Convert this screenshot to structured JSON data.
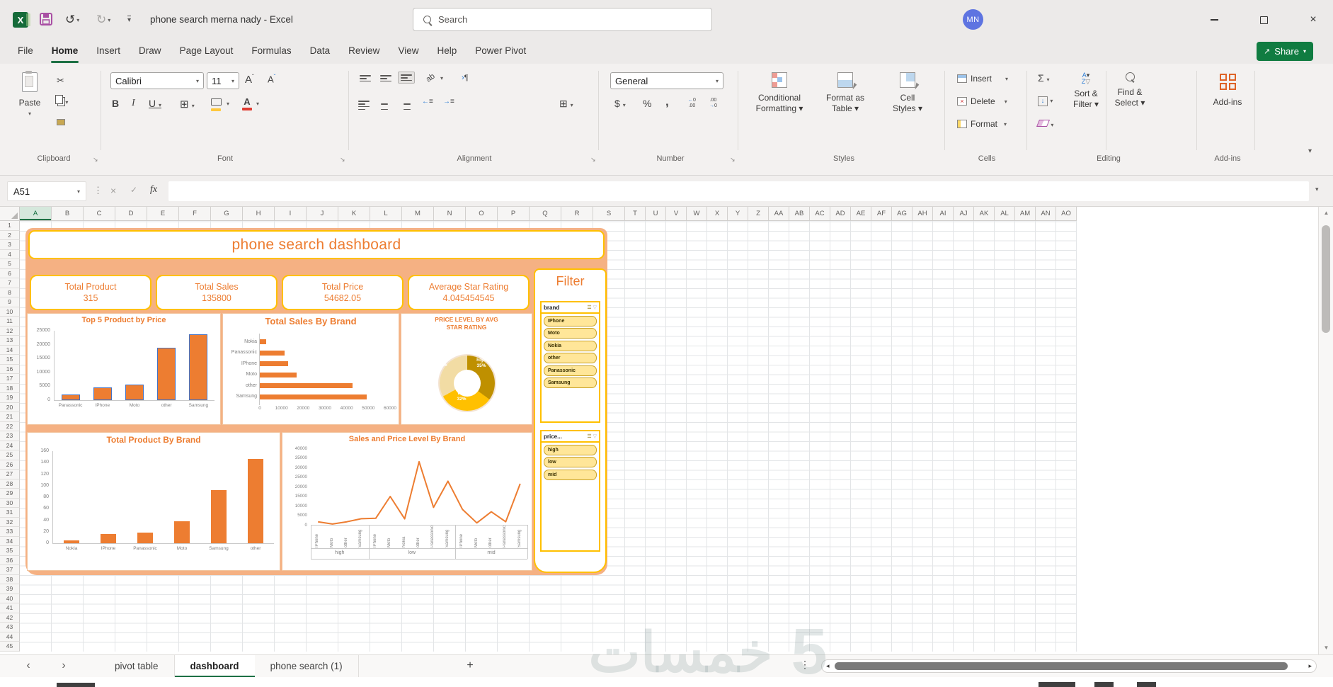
{
  "app": {
    "title": "phone search merna nady  -  Excel",
    "search_placeholder": "Search",
    "avatar": "MN"
  },
  "menu": {
    "tabs": [
      "File",
      "Home",
      "Insert",
      "Draw",
      "Page Layout",
      "Formulas",
      "Data",
      "Review",
      "View",
      "Help",
      "Power Pivot"
    ],
    "active_tab": "Home",
    "share_label": "Share"
  },
  "ribbon": {
    "paste": "Paste",
    "font_name": "Calibri",
    "font_size": "11",
    "number_format": "General",
    "conditional_formatting": [
      "Conditional",
      "Formatting ▾"
    ],
    "format_as_table": [
      "Format as",
      "Table ▾"
    ],
    "cell_styles": [
      "Cell",
      "Styles ▾"
    ],
    "insert": "Insert",
    "delete": "Delete",
    "format": "Format",
    "sort_filter": [
      "Sort &",
      "Filter ▾"
    ],
    "find_select": [
      "Find &",
      "Select ▾"
    ],
    "addins_label": "Add-ins",
    "groups": [
      "Clipboard",
      "Font",
      "Alignment",
      "Number",
      "Styles",
      "Cells",
      "Editing",
      "Add-ins"
    ]
  },
  "formula_bar": {
    "name_box": "A51",
    "fx": "fx"
  },
  "sheet": {
    "columns_narrow": [
      "A",
      "B",
      "C",
      "D",
      "E",
      "F",
      "G",
      "H",
      "I",
      "J",
      "K",
      "L",
      "M",
      "N",
      "O",
      "P",
      "Q",
      "R",
      "S"
    ],
    "columns_wide": [
      "T",
      "U",
      "V",
      "W",
      "X",
      "Y",
      "Z",
      "AA",
      "AB",
      "AC",
      "AD",
      "AE",
      "AF",
      "AG",
      "AH",
      "AI",
      "AJ",
      "AK",
      "AL",
      "AM",
      "AN",
      "AO"
    ],
    "row_count": 45,
    "selected_column": "A"
  },
  "dashboard": {
    "title": "phone search dashboard",
    "kpis": [
      {
        "label": "Total Product",
        "value": "315"
      },
      {
        "label": "Total Sales",
        "value": "135800"
      },
      {
        "label": "Total Price",
        "value": "54682.05"
      },
      {
        "label": "Average Star Rating",
        "value": "4.045454545"
      }
    ],
    "filter": {
      "title": "Filter",
      "slicers": [
        {
          "header": "brand",
          "items": [
            "IPhone",
            "Moto",
            "Nokia",
            "other",
            "Panassonic",
            "Samsung"
          ]
        },
        {
          "header": "price...",
          "items": [
            "high",
            "low",
            "mid"
          ]
        }
      ]
    }
  },
  "chart_data": [
    {
      "type": "bar",
      "title": "Top 5 Product by Price",
      "categories": [
        "Panassonic",
        "IPhone",
        "Moto",
        "other",
        "Samsung"
      ],
      "values": [
        2000,
        4600,
        5700,
        19000,
        23800
      ],
      "ylim": [
        0,
        25000
      ],
      "yticks": [
        0,
        5000,
        10000,
        15000,
        20000,
        25000
      ],
      "bar_color": "#ED7D31",
      "bar_border": "#4472C4"
    },
    {
      "type": "bar",
      "orientation": "horizontal",
      "title": "Total Sales By Brand",
      "categories": [
        "Nokia",
        "Panassonic",
        "IPhone",
        "Moto",
        "other",
        "Samsung"
      ],
      "values": [
        3000,
        11300,
        13100,
        17000,
        42600,
        49200
      ],
      "xlim": [
        0,
        60000
      ],
      "xticks": [
        0,
        10000,
        20000,
        30000,
        40000,
        50000,
        60000
      ],
      "bar_color": "#ED7D31"
    },
    {
      "type": "pie",
      "title": [
        "PRICE LEVEL BY AVG",
        "STAR RATING"
      ],
      "labels": [
        "high",
        "low",
        "mid"
      ],
      "values": [
        35,
        32,
        33
      ],
      "unit": "%",
      "colors": [
        "#BF9000",
        "#FFC000",
        "#F2DCA4"
      ]
    },
    {
      "type": "bar",
      "title": "Total Product By Brand",
      "categories": [
        "Nokia",
        "IPhone",
        "Panassonic",
        "Moto",
        "Samsung",
        "other"
      ],
      "values": [
        5,
        16,
        18,
        38,
        92,
        146
      ],
      "ylim": [
        0,
        160
      ],
      "yticks": [
        0,
        20,
        40,
        60,
        80,
        100,
        120,
        140,
        160
      ],
      "bar_color": "#ED7D31"
    },
    {
      "type": "line",
      "title": "Sales and Price Level By Brand",
      "ylim": [
        0,
        40000
      ],
      "yticks": [
        0,
        5000,
        10000,
        15000,
        20000,
        25000,
        30000,
        35000,
        40000
      ],
      "line_color": "#ED7D31",
      "groups": [
        {
          "label": "high",
          "categories": [
            "IPhone",
            "Moto",
            "other",
            "Samsung"
          ],
          "values": [
            1600,
            400,
            1600,
            3200
          ]
        },
        {
          "label": "low",
          "categories": [
            "IPhone",
            "Moto",
            "Nokia",
            "other",
            "Panassonic",
            "Samsung"
          ],
          "values": [
            3400,
            14800,
            3100,
            33000,
            9100,
            22800
          ]
        },
        {
          "label": "mid",
          "categories": [
            "IPhone",
            "Moto",
            "other",
            "Panassonic",
            "Samsung"
          ],
          "values": [
            8100,
            1000,
            6800,
            1600,
            21500
          ]
        }
      ]
    }
  ],
  "tabs_bar": {
    "tabs": [
      "pivot table",
      "dashboard",
      "phone search (1)"
    ],
    "active_tab": "dashboard"
  },
  "watermark": {
    "text": "خمسات",
    "numeral": "5"
  },
  "colors": {
    "accent": "#ED7D31",
    "gold": "#FFC000",
    "peach": "#F5B183",
    "green": "#107C41",
    "slicer_fill": "#FFE699"
  }
}
